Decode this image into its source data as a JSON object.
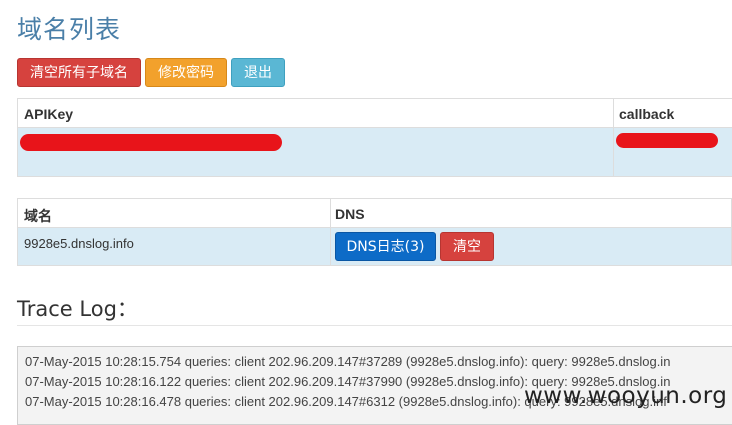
{
  "page": {
    "title": "域名列表"
  },
  "toolbar": {
    "clear_label": "清空所有子域名",
    "change_password_label": "修改密码",
    "logout_label": "退出"
  },
  "api_table": {
    "headers": [
      "APIKey",
      "callback"
    ]
  },
  "domain_table": {
    "headers": [
      "域名",
      "DNS"
    ],
    "rows": [
      {
        "domain": "9928e5.dnslog.info",
        "dns_button": "DNS日志(3)",
        "clear_button": "清空"
      }
    ]
  },
  "trace": {
    "title": "Trace Log：",
    "lines": [
      "07-May-2015 10:28:15.754 queries: client 202.96.209.147#37289 (9928e5.dnslog.info): query: 9928e5.dnslog.in",
      "07-May-2015 10:28:16.122 queries: client 202.96.209.147#37990 (9928e5.dnslog.info): query: 9928e5.dnslog.in",
      "07-May-2015 10:28:16.478 queries: client 202.96.209.147#6312 (9928e5.dnslog.info): query: 9928e5.dnslog.inf"
    ]
  },
  "watermark": "www.wooyun.org",
  "colors": {
    "title": "#4a7fa8",
    "danger": "#d6423e",
    "warning": "#f2a12c",
    "info": "#5ab7d4",
    "primary": "#0d6bc7",
    "row_highlight": "#d9ebf5"
  }
}
